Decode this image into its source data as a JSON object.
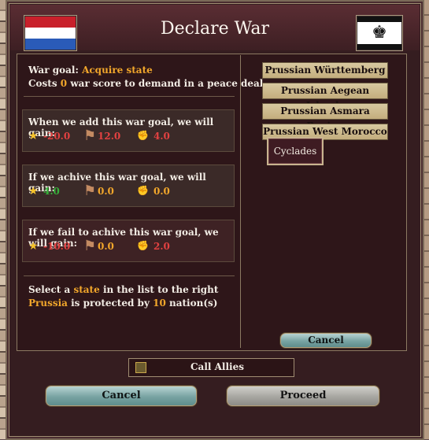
{
  "title": "Declare War",
  "flags": {
    "left": "netherlands-flag",
    "right": "prussia-flag"
  },
  "info": {
    "war_goal_prefix": "War goal:",
    "war_goal": "Acquire state",
    "costs_prefix": "Costs",
    "costs_value": "0",
    "costs_suffix": "war score to demand in a peace deal"
  },
  "gains": [
    {
      "title": "When we add this war goal, we will gain:",
      "prestige": "-20.0",
      "infamy": "12.0",
      "militancy": "4.0"
    },
    {
      "title": "If we achive this war goal, we will gain:",
      "prestige": "4.0",
      "infamy": "0.0",
      "militancy": "0.0"
    },
    {
      "title": "If we fail to achive this war goal, we will gain:",
      "prestige": "-10.0",
      "infamy": "0.0",
      "militancy": "2.0"
    }
  ],
  "footer": {
    "select_prefix": "Select a",
    "select_word": "state",
    "select_suffix": "in the list to the right",
    "country": "Prussia",
    "protected_mid": "is protected by",
    "protected_count": "10",
    "protected_suffix": "nation(s)"
  },
  "states": [
    "Prussian Württemberg",
    "Prussian Aegean Islands",
    "Prussian Asmara Region",
    "Prussian West Morocco"
  ],
  "selected_state": "Cyclades",
  "buttons": {
    "list_cancel": "Cancel",
    "call_allies": "Call Allies",
    "cancel": "Cancel",
    "proceed": "Proceed"
  },
  "colors": {
    "highlight": "#f2a72b",
    "negative": "#e24141",
    "positive": "#36b03a",
    "window_bg": "#351d20"
  }
}
